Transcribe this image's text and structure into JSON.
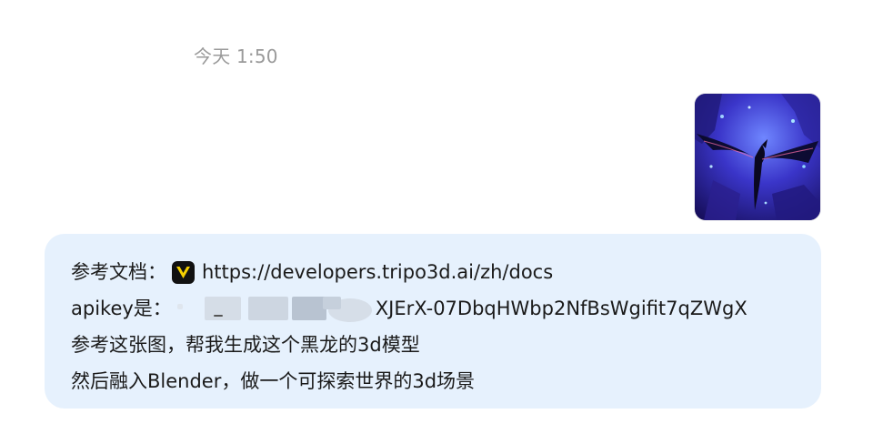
{
  "timestamp": "今天 1:50",
  "attachment": {
    "icon": "image-thumbnail"
  },
  "message": {
    "docs_label": "参考文档：",
    "docs_icon": "tripo-app-icon",
    "docs_link": "https://developers.tripo3d.ai/zh/docs",
    "apikey_label": "apikey是：",
    "apikey_visible": "XJErX-07DbqHWbp2NfBsWgifit7qZWgX",
    "line3": "参考这张图，帮我生成这个黑龙的3d模型",
    "line4": "然后融入Blender，做一个可探索世界的3d场景"
  },
  "colors": {
    "bubble_bg": "#e6f1fd",
    "timestamp": "#9a9a9a",
    "text": "#1a1a1a",
    "app_icon_accent": "#f5d000"
  }
}
